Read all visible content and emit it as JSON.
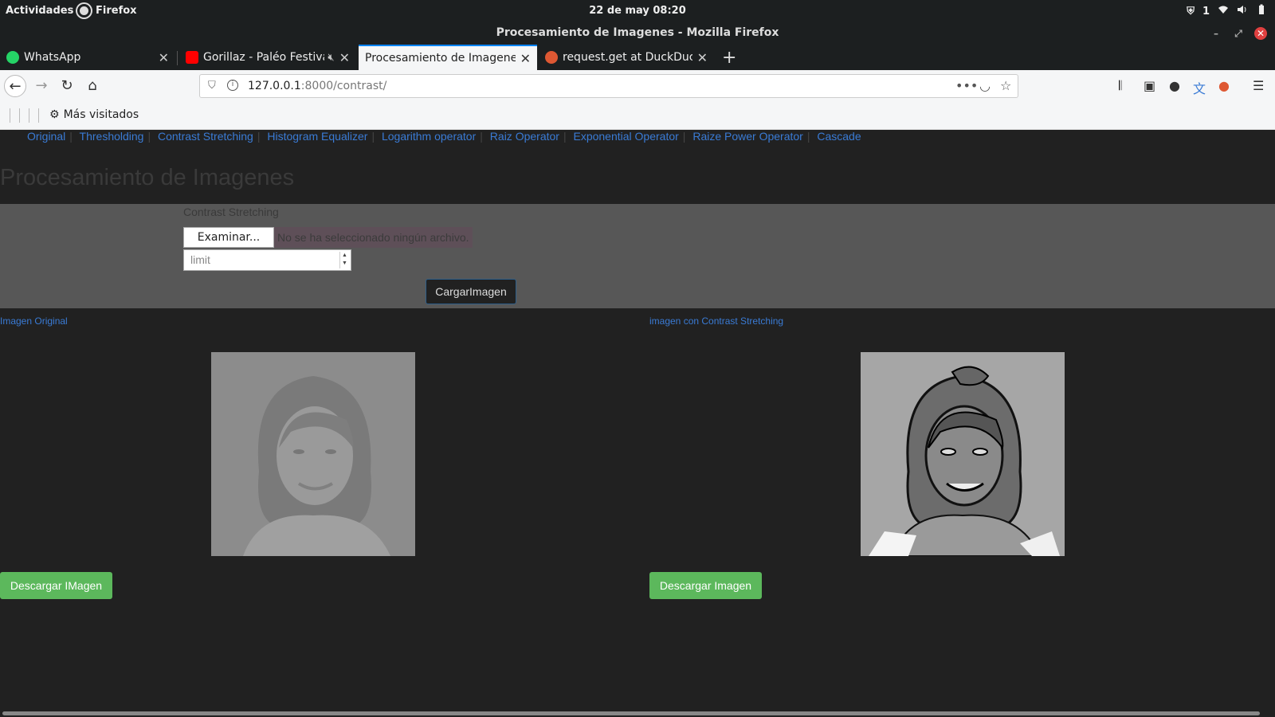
{
  "topbar": {
    "activities": "Actividades",
    "app": "Firefox",
    "clock": "22 de may  08:20",
    "notif_count": "1"
  },
  "window": {
    "title": "Procesamiento de Imagenes - Mozilla Firefox"
  },
  "tabs": [
    {
      "label": "WhatsApp",
      "favicon_color": "#25d366"
    },
    {
      "label": "Gorillaz - Paléo Festival",
      "favicon_color": "#ff0000"
    },
    {
      "label": "Procesamiento de Imagenes",
      "favicon_color": ""
    },
    {
      "label": "request.get at DuckDuckGo",
      "favicon_color": "#de5833"
    }
  ],
  "nav": {
    "url_host": "127.0.0.1",
    "url_rest": ":8000/contrast/"
  },
  "bookmarks": {
    "most_visited": "Más visitados"
  },
  "page": {
    "menu": [
      "Original",
      "Thresholding",
      "Contrast Stretching",
      "Histogram Equalizer",
      "Logarithm operator",
      "Raiz Operator",
      "Exponential Operator",
      "Raize Power Operator",
      "Cascade"
    ],
    "title": "Procesamiento de Imagenes",
    "form_label": "Contrast Stretching",
    "browse_label": "Examinar...",
    "file_status": "No se ha seleccionado ningún archivo.",
    "limit_placeholder": "limit",
    "upload_label": "CargarImagen",
    "original_caption": "Imagen Original",
    "processed_caption": "imagen con Contrast Stretching",
    "download_original": "Descargar IMagen",
    "download_processed": "Descargar Imagen"
  },
  "colors": {
    "accent_link": "#3a7bd5",
    "download_button": "#5cb85c",
    "tab_active_border": "#0a84ff"
  }
}
